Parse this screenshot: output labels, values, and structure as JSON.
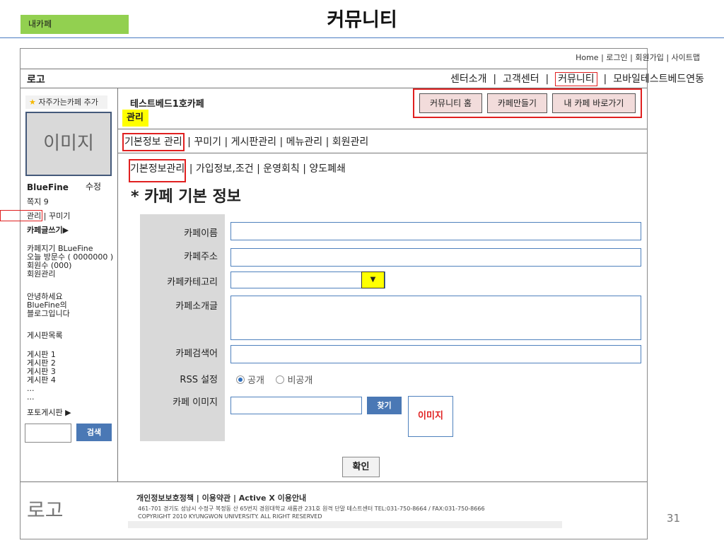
{
  "slide": {
    "tag": "내카페",
    "title": "커뮤니티",
    "page_number": "31"
  },
  "header": {
    "top_links": "Home | 로그인 | 회원가입 | 사이트맵",
    "logo": "로고",
    "gnb": {
      "center": "센터소개",
      "customer": "고객센터",
      "community": "커뮤니티",
      "mobile": "모바일테스트베드연동"
    }
  },
  "sidebar": {
    "favorite": "자주가는카페 추가",
    "image": "이미지",
    "nickname": "BlueFine",
    "edit": "수정",
    "message": "쪽지 9",
    "manage": "관리",
    "decorate": "꾸미기",
    "write": "카페글쓰기▶",
    "info": [
      "카페지기 BLueFine",
      "오늘 방문수 ( 0000000 )",
      "회원수 (000)",
      "회원관리"
    ],
    "greeting": [
      "안녕하세요",
      "BlueFine의",
      "블로그입니다"
    ],
    "board_list_title": "게시판목록",
    "boards": [
      "게시판 1",
      "게시판 2",
      "게시판 3",
      "게시판 4",
      "...",
      "..."
    ],
    "photo_board": "포토게시판 ▶",
    "search_button": "검색"
  },
  "main": {
    "cafe_name": "테스트베드1호카페",
    "manage_tag": "관리",
    "buttons": {
      "community_home": "커뮤니티 홈",
      "create_cafe": "카페만들기",
      "my_cafe": "내 카페 바로가기"
    },
    "menu": {
      "basic": "기본정보 관리",
      "rest": "꾸미기 | 게시판관리 | 메뉴관리 | 회원관리"
    },
    "submenu": {
      "basic": "기본정보관리",
      "rest": "가입정보,조건 | 운영회칙 | 양도폐쇄"
    },
    "section_title": "* 카페 기본 정보",
    "form": {
      "name": "카페이름",
      "address": "카페주소",
      "category": "카페카테고리",
      "intro": "카페소개글",
      "keyword": "카페검색어",
      "rss": "RSS 설정",
      "rss_public": "공개",
      "rss_private": "비공개",
      "image": "카페 이미지",
      "find": "찾기",
      "image_box": "이미지",
      "dropdown_icon": "triangle-down-icon"
    },
    "confirm": "확인"
  },
  "footer": {
    "logo": "로고",
    "links": "개인정보보호정책 | 이용약관 | Active X 이용안내",
    "address": "461-701 경기도 성남시 수정구 복정동 산 65번지 경원대학교 새롬관 231호 원격 단말 테스트센터 TEL:031-750-8664 / FAX:031-750-8666",
    "copyright": "COPYRIGHT 2010 KYUNGWON UNIVERSITY. ALL RIGHT RESERVED"
  },
  "colors": {
    "tag_green": "#92d050",
    "highlight_red": "#e02020",
    "button_blue": "#4a78b5",
    "highlight_yellow": "#ffff00"
  }
}
